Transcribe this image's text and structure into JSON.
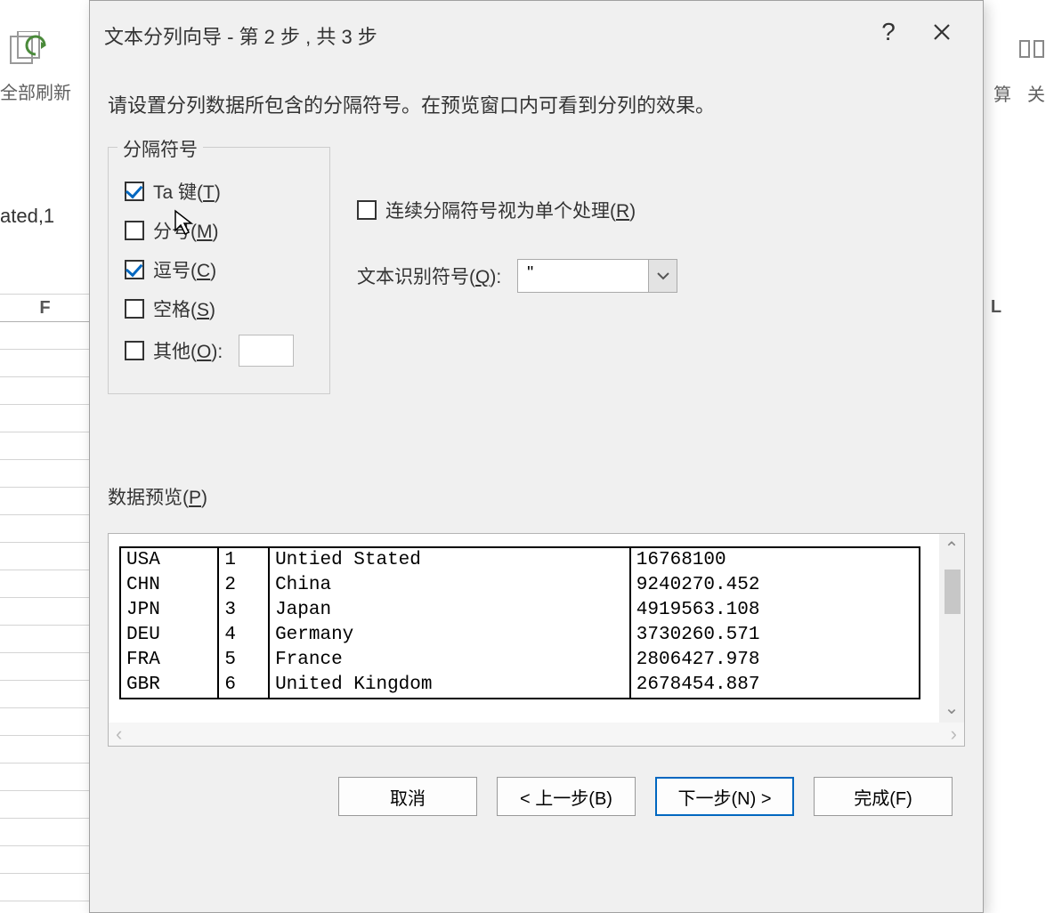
{
  "background": {
    "refresh_label": "全部刷新",
    "calc_label": "算",
    "rel_label": "关",
    "cell_text": "ated,1",
    "col_f": "F",
    "col_l": "L"
  },
  "dialog": {
    "title": "文本分列向导 - 第 2 步 , 共 3 步",
    "help": "?",
    "instruction": "请设置分列数据所包含的分隔符号。在预览窗口内可看到分列的效果。",
    "delimiters": {
      "group_title": "分隔符号",
      "tab": {
        "label_pre": "Ta",
        "label_post": " 键(",
        "accel": "T",
        "label_suf": ")",
        "checked": true
      },
      "semicolon": {
        "label": "分号(",
        "accel": "M",
        "label_suf": ")",
        "checked": false
      },
      "comma": {
        "label": "逗号(",
        "accel": "C",
        "label_suf": ")",
        "checked": true
      },
      "space": {
        "label": "空格(",
        "accel": "S",
        "label_suf": ")",
        "checked": false
      },
      "other": {
        "label": "其他(",
        "accel": "O",
        "label_suf": "):",
        "checked": false,
        "value": ""
      }
    },
    "consecutive": {
      "label": "连续分隔符号视为单个处理(",
      "accel": "R",
      "label_suf": ")",
      "checked": false
    },
    "qualifier": {
      "label": "文本识别符号(",
      "accel": "Q",
      "label_suf": "):",
      "value": "\""
    },
    "preview": {
      "label": "数据预览(",
      "accel": "P",
      "label_suf": ")",
      "rows": [
        [
          "USA",
          "1",
          "Untied Stated",
          "16768100"
        ],
        [
          "CHN",
          "2",
          "China",
          "9240270.452"
        ],
        [
          "JPN",
          "3",
          "Japan",
          "4919563.108"
        ],
        [
          "DEU",
          "4",
          "Germany",
          "3730260.571"
        ],
        [
          "FRA",
          "5",
          "France",
          "2806427.978"
        ],
        [
          "GBR",
          "6",
          "United Kingdom",
          "2678454.887"
        ]
      ]
    },
    "buttons": {
      "cancel": "取消",
      "back": "< 上一步(B)",
      "next": "下一步(N) >",
      "finish": "完成(F)"
    }
  }
}
